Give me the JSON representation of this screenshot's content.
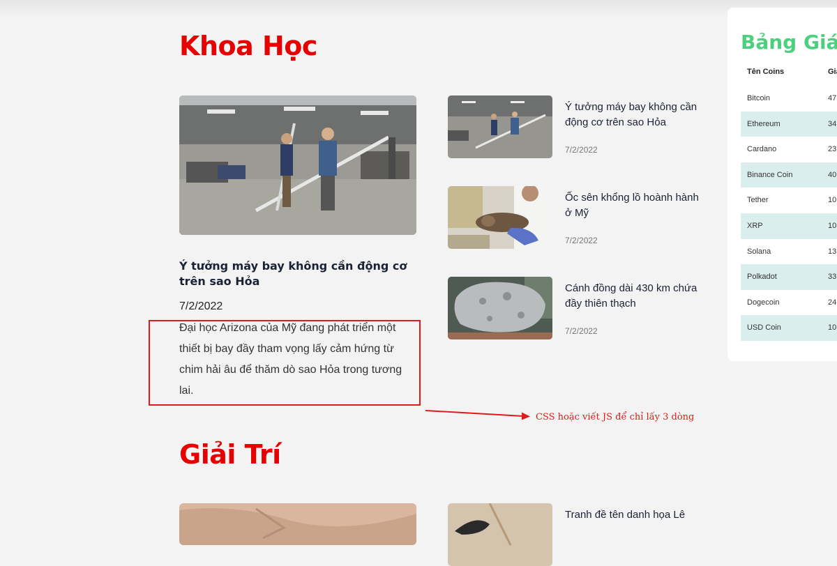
{
  "sections": {
    "science_title": "Khoa Học",
    "entertainment_title": "Giải Trí"
  },
  "featured": {
    "title": "Ý tưởng máy bay không cần động cơ trên sao Hỏa",
    "date": "7/2/2022",
    "description": "Đại học Arizona của Mỹ đang phát triển một thiết bị bay đầy tham vọng lấy cảm hứng từ chim hải âu để thăm dò sao Hỏa trong tương lai."
  },
  "side_articles": [
    {
      "title": "Ý tưởng máy bay không cần động cơ trên sao Hỏa",
      "date": "7/2/2022"
    },
    {
      "title": "Ốc sên khổng lồ hoành hành ở Mỹ",
      "date": "7/2/2022"
    },
    {
      "title": "Cánh đồng dài 430 km chứa đầy thiên thạch",
      "date": "7/2/2022"
    },
    {
      "title": "Tranh đề tên danh họa Lê",
      "date": ""
    }
  ],
  "annotation": {
    "note": "CSS hoặc viết JS để chỉ lấy 3 dòng",
    "color": "#e01b1b"
  },
  "coin_table": {
    "title": "Bảng Giá C",
    "headers": {
      "name": "Tên Coins",
      "price": "Gia"
    },
    "rows": [
      {
        "name": "Bitcoin",
        "price": "47"
      },
      {
        "name": "Ethereum",
        "price": "34"
      },
      {
        "name": "Cardano",
        "price": "23"
      },
      {
        "name": "Binance Coin",
        "price": "40"
      },
      {
        "name": "Tether",
        "price": "10"
      },
      {
        "name": "XRP",
        "price": "10"
      },
      {
        "name": "Solana",
        "price": "13"
      },
      {
        "name": "Polkadot",
        "price": "33"
      },
      {
        "name": "Dogecoin",
        "price": "24"
      },
      {
        "name": "USD Coin",
        "price": "10"
      }
    ]
  },
  "colors": {
    "section_title": "#e60000",
    "coin_title": "#4cd07d",
    "alt_row": "#d9eeed"
  }
}
